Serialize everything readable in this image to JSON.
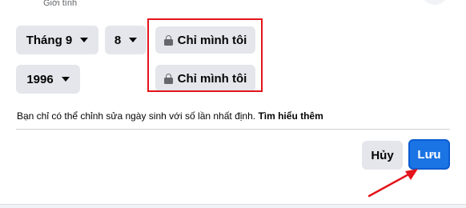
{
  "header": {
    "field_label": "Giới tính"
  },
  "birthday": {
    "month": {
      "value": "Tháng 9"
    },
    "day": {
      "value": "8"
    },
    "year": {
      "value": "1996"
    }
  },
  "privacy": {
    "date_audience_label": "Chỉ mình tôi",
    "year_audience_label": "Chỉ mình tôi",
    "icon": "lock-icon"
  },
  "info": {
    "text": "Bạn chỉ có thể chỉnh sửa ngày sinh với số lần nhất định.",
    "link_label": "Tìm hiểu thêm"
  },
  "actions": {
    "cancel_label": "Hủy",
    "save_label": "Lưu"
  },
  "colors": {
    "primary": "#1b74e4",
    "button_gray": "#e4e6eb",
    "annotation_red": "#e3141c"
  }
}
